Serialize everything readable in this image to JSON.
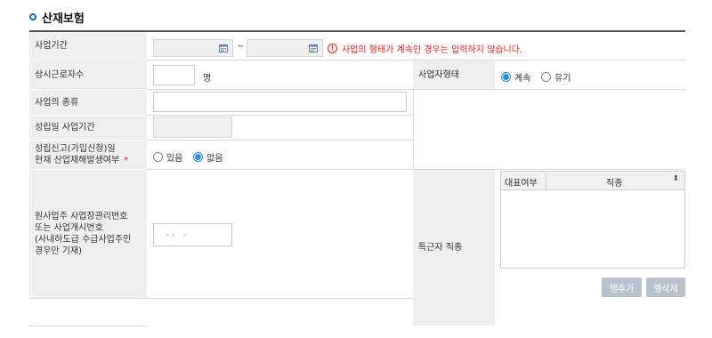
{
  "section": {
    "title": "산재보험"
  },
  "labels": {
    "business_period": "사업기간",
    "regular_workers": "상시근로자수",
    "business_type": "사업의 종류",
    "establish_period": "성립일 사업기간",
    "accident_line1": "성립신고(가입신청)일",
    "accident_line2": "현재 산업재해발생여부",
    "contractor_line1": "원사업주 사업장관리번호",
    "contractor_line2": "또는 사업개시번호",
    "contractor_line3": "(사내하도급 수급사업주인",
    "contractor_line4": "경우만 기재)",
    "business_form": "사업자형태",
    "special_job": "특근자 직종"
  },
  "business_period": {
    "tilde": "~",
    "warning": "사업의 형태가 계속인 경우는 입력하지 않습니다."
  },
  "regular_workers": {
    "value": "",
    "unit": "명"
  },
  "business_form": {
    "options": [
      "계속",
      "유기"
    ],
    "selected": "계속"
  },
  "accident": {
    "options": [
      "있음",
      "없음"
    ],
    "selected": "없음",
    "required_mark": "*"
  },
  "contractor_number": {
    "value": "- -   -"
  },
  "job_grid": {
    "columns": [
      "대표여부",
      "직종"
    ],
    "sort_icon": "sort-icon"
  },
  "buttons": {
    "add_row": "행추가",
    "delete_row": "행삭제"
  },
  "colors": {
    "accent": "#2a8dd8",
    "error": "#e02020",
    "button": "#b9c2cc",
    "label_bg": "#efefef"
  }
}
